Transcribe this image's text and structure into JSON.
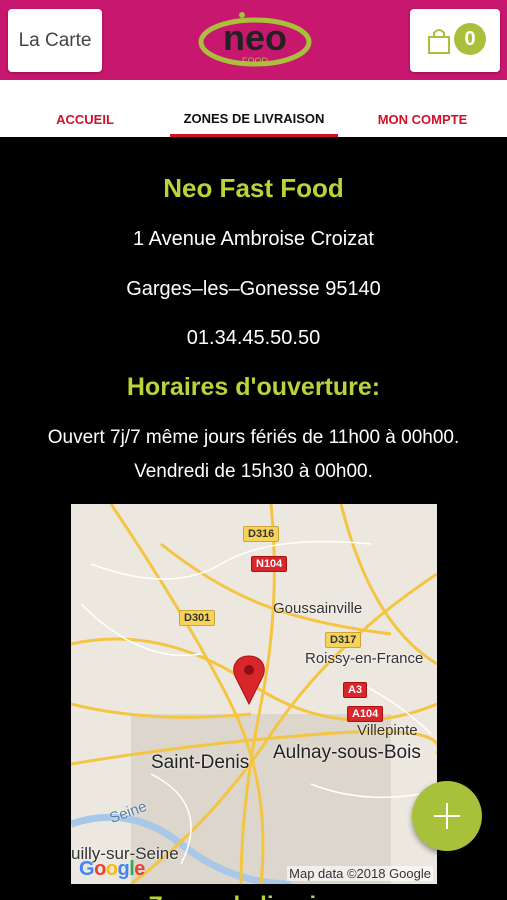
{
  "header": {
    "menu_label": "La Carte",
    "logo_text": "neo",
    "logo_sub": "FOOD",
    "cart_count": "0",
    "brand_color": "#c8176f",
    "accent_color": "#a8c03a"
  },
  "tabs": [
    {
      "label": "ACCUEIL"
    },
    {
      "label": "ZONES DE LIVRAISON",
      "active": true
    },
    {
      "label": "MON COMPTE"
    }
  ],
  "restaurant": {
    "name": "Neo Fast Food",
    "address1": "1 Avenue Ambroise Croizat",
    "address2": "Garges–les–Gonesse 95140",
    "phone": "01.34.45.50.50"
  },
  "hours": {
    "title": "Horaires d'ouverture:",
    "line1": "Ouvert 7j/7 même jours fériés de 11h00 à 00h00.",
    "line2": "Vendredi de 15h30 à 00h00."
  },
  "map": {
    "places": [
      "Goussainville",
      "Roissy-en-France",
      "Villepinte",
      "Aulnay-sous-Bois",
      "Saint-Denis",
      "Seine",
      "uilly-sur-Seine"
    ],
    "roads": [
      "D316",
      "N104",
      "D301",
      "D317",
      "A3",
      "A104"
    ],
    "credit": "Map data ©2018 Google",
    "google": "Google"
  },
  "fab_icon": "plus-icon",
  "next_heading": "Zones de livraison"
}
